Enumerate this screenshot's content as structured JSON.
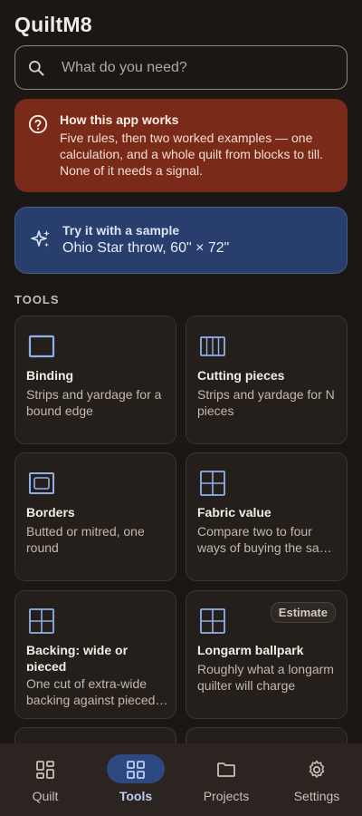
{
  "app": {
    "title": "QuiltM8"
  },
  "search": {
    "placeholder": "What do you need?",
    "icon": "search-icon"
  },
  "help_card": {
    "title": "How this app works",
    "body": "Five rules, then two worked examples — one calculation, and a whole quilt from blocks to till. None of it needs a signal.",
    "icon": "question-circle-icon",
    "color": "#7a2a19"
  },
  "sample_card": {
    "title": "Try it with a sample",
    "subtitle": "Ohio Star throw, 60\" × 72\"",
    "icon": "sparkle-icon",
    "color": "#283e6c"
  },
  "tools": {
    "section_label": "TOOLS",
    "items": [
      {
        "title": "Binding",
        "desc": "Strips and yardage for a bound edge",
        "icon": "frame-icon"
      },
      {
        "title": "Cutting pieces",
        "desc": "Strips and yardage for N pieces",
        "icon": "strips-icon"
      },
      {
        "title": "Borders",
        "desc": "Butted or mitred, one round",
        "icon": "border-icon"
      },
      {
        "title": "Fabric value",
        "desc": "Compare two to four ways of buying the same fabric",
        "icon": "grid-icon"
      },
      {
        "title": "Backing: wide or pieced",
        "desc": "One cut of extra-wide backing against pieced backing",
        "icon": "grid-icon"
      },
      {
        "title": "Longarm ballpark",
        "desc": "Roughly what a longarm quilter will charge",
        "icon": "grid-icon",
        "badge": "Estimate"
      }
    ]
  },
  "nav": {
    "items": [
      {
        "label": "Quilt",
        "icon": "dashboard-icon",
        "active": false
      },
      {
        "label": "Tools",
        "icon": "apps-grid-icon",
        "active": true
      },
      {
        "label": "Projects",
        "icon": "folder-icon",
        "active": false
      },
      {
        "label": "Settings",
        "icon": "gear-icon",
        "active": false
      }
    ],
    "active_color": "#2e4880"
  }
}
